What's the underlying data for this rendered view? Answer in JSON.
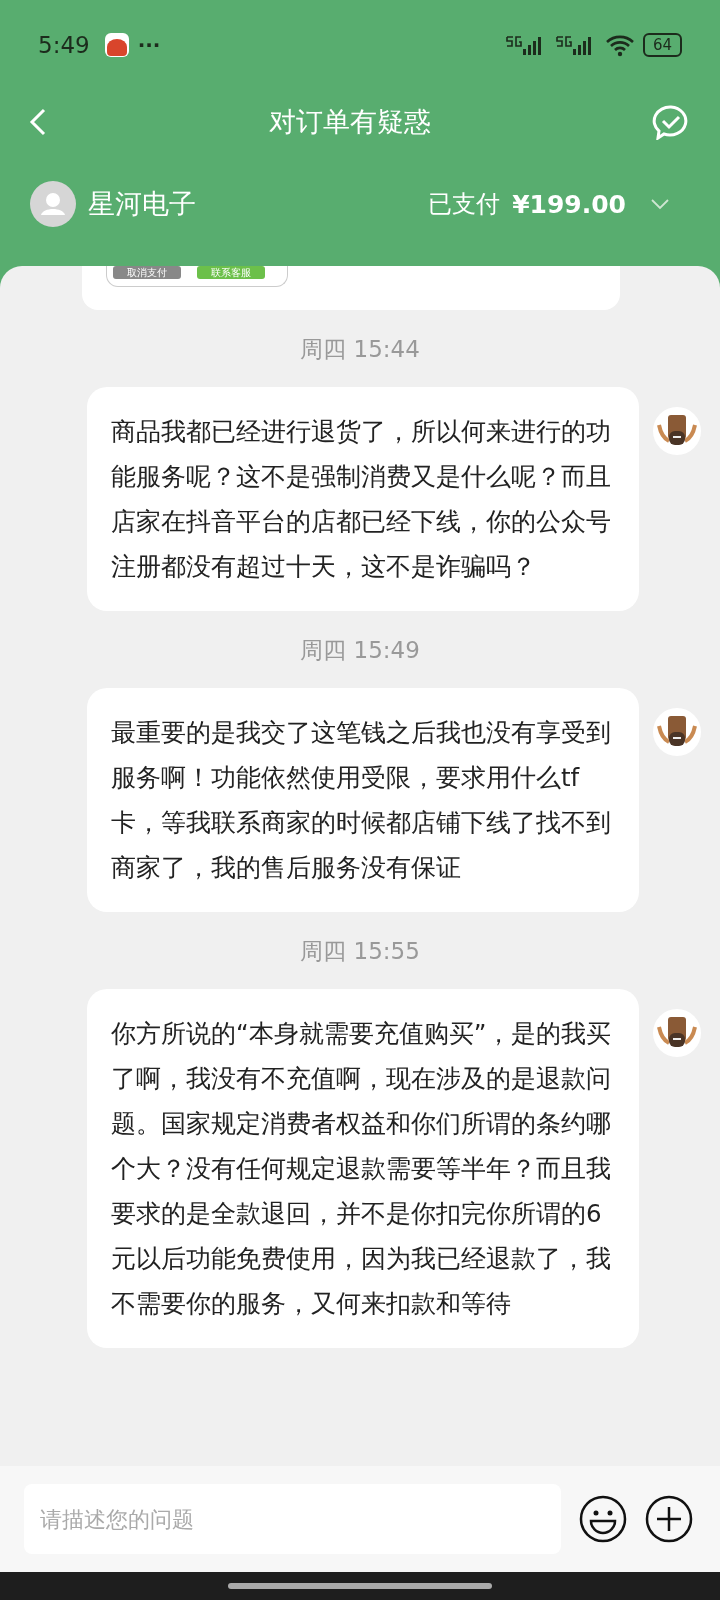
{
  "status_bar": {
    "time": "5:49",
    "more": "···",
    "battery": "64"
  },
  "header": {
    "title": "对订单有疑惑"
  },
  "order": {
    "shop": "星河电子",
    "status": "已支付",
    "amount": "¥199.00"
  },
  "order_card": {
    "buttons": [
      "取消支付",
      "联系客服"
    ]
  },
  "messages": [
    {
      "time": "周四 15:44",
      "text": "商品我都已经进行退货了，所以何来进行的功能服务呢？这不是强制消费又是什么呢？而且店家在抖音平台的店都已经下线，你的公众号注册都没有超过十天，这不是诈骗吗？"
    },
    {
      "time": "周四 15:49",
      "text": "最重要的是我交了这笔钱之后我也没有享受到服务啊！功能依然使用受限，要求用什么tf卡，等我联系商家的时候都店铺下线了找不到商家了，我的售后服务没有保证"
    },
    {
      "time": "周四 15:55",
      "text": "你方所说的“本身就需要充值购买”，是的我买了啊，我没有不充值啊，现在涉及的是退款问题。国家规定消费者权益和你们所谓的条约哪个大？没有任何规定退款需要等半年？而且我要求的是全款退回，并不是你扣完你所谓的6元以后功能免费使用，因为我已经退款了，我不需要你的服务，又何来扣款和等待"
    }
  ],
  "composer": {
    "placeholder": "请描述您的问题"
  }
}
